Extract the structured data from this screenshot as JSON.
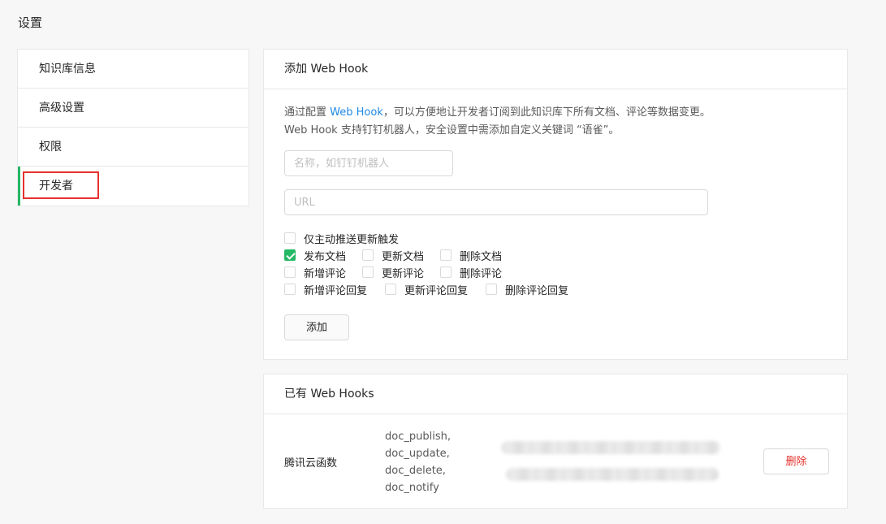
{
  "page": {
    "title": "设置"
  },
  "sidebar": {
    "items": [
      {
        "label": "知识库信息"
      },
      {
        "label": "高级设置"
      },
      {
        "label": "权限"
      },
      {
        "label": "开发者"
      }
    ]
  },
  "add_card": {
    "title": "添加 Web Hook",
    "desc_prefix": "通过配置 ",
    "desc_link": "Web Hook",
    "desc_suffix": "，可以方便地让开发者订阅到此知识库下所有文档、评论等数据变更。Web Hook 支持钉钉机器人，安全设置中需添加自定义关键词 “语雀”。",
    "name_placeholder": "名称，如钉钉机器人",
    "url_placeholder": "URL",
    "checkboxes": {
      "only_push": {
        "label": "仅主动推送更新触发",
        "checked": false
      },
      "publish_doc": {
        "label": "发布文档",
        "checked": true
      },
      "update_doc": {
        "label": "更新文档",
        "checked": false
      },
      "delete_doc": {
        "label": "删除文档",
        "checked": false
      },
      "new_comment": {
        "label": "新增评论",
        "checked": false
      },
      "update_comment": {
        "label": "更新评论",
        "checked": false
      },
      "delete_comment": {
        "label": "删除评论",
        "checked": false
      },
      "new_reply": {
        "label": "新增评论回复",
        "checked": false
      },
      "update_reply": {
        "label": "更新评论回复",
        "checked": false
      },
      "delete_reply": {
        "label": "删除评论回复",
        "checked": false
      }
    },
    "add_button": "添加"
  },
  "list_card": {
    "title": "已有 Web Hooks",
    "hooks": [
      {
        "name": "腾讯云函数",
        "events": [
          "doc_publish,",
          "doc_update,",
          "doc_delete,",
          "doc_notify"
        ],
        "delete_label": "删除"
      }
    ]
  },
  "colors": {
    "accent": "#25b864",
    "link": "#1e88e5",
    "danger": "#e5322d"
  }
}
